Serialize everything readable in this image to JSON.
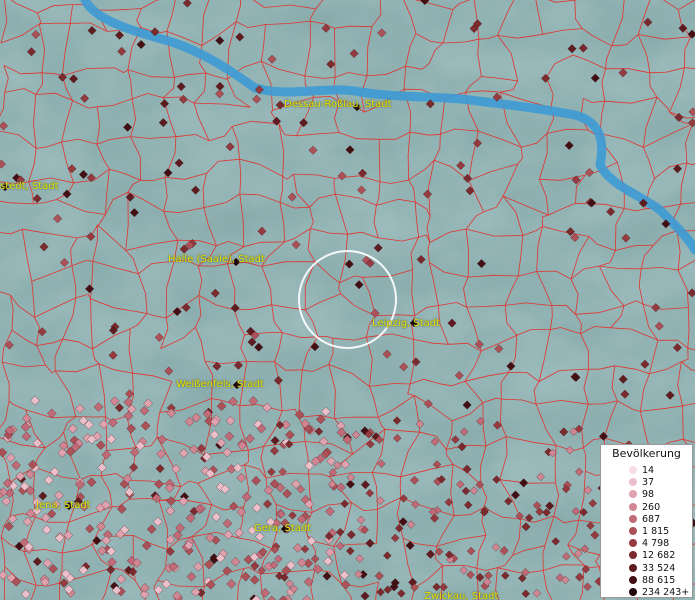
{
  "cities": [
    {
      "key": "dessau",
      "label": "Dessau-Roßlau, Stadt"
    },
    {
      "key": "stedt",
      "label": "stedt, Stadt"
    },
    {
      "key": "halle",
      "label": "Halle (Saale), Stadt"
    },
    {
      "key": "leipzig",
      "label": "Leipzig, Stadt"
    },
    {
      "key": "weissenfels",
      "label": "Weißenfels, Stadt"
    },
    {
      "key": "jena",
      "label": "Jena, Stadt"
    },
    {
      "key": "gera",
      "label": "Gera, Stadt"
    },
    {
      "key": "zwickau",
      "label": "Zwickau, Stadt"
    }
  ],
  "legend": {
    "title": "Bevölkerung",
    "items": [
      {
        "label": "14",
        "color": "#f6dce3"
      },
      {
        "label": "37",
        "color": "#ecc0cb"
      },
      {
        "label": "98",
        "color": "#dfa3b0"
      },
      {
        "label": "260",
        "color": "#d08693"
      },
      {
        "label": "687",
        "color": "#c06b77"
      },
      {
        "label": "1 815",
        "color": "#ad5158"
      },
      {
        "label": "4 798",
        "color": "#953b40"
      },
      {
        "label": "12 682",
        "color": "#7b2a2e"
      },
      {
        "label": "33 524",
        "color": "#5e1c20"
      },
      {
        "label": "88 615",
        "color": "#421014"
      },
      {
        "label": "234 243",
        "color": "#1f0507"
      }
    ],
    "overflow_mark": "+"
  },
  "colors": {
    "boundary": "#e0332e",
    "river": "#3d9ad4",
    "label": "#e8e400"
  }
}
